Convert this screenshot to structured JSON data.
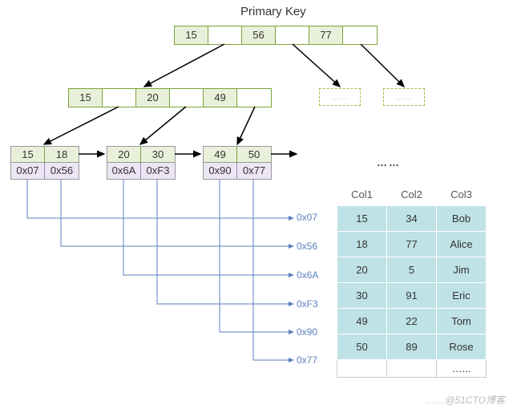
{
  "title": "Primary Key",
  "root": {
    "k1": "15",
    "k2": "56",
    "k3": "77"
  },
  "mid": {
    "k1": "15",
    "k2": "20",
    "k3": "49"
  },
  "ghost_label": "……",
  "leaves": [
    {
      "keys": [
        "15",
        "18"
      ],
      "ptrs": [
        "0x07",
        "0x56"
      ]
    },
    {
      "keys": [
        "20",
        "30"
      ],
      "ptrs": [
        "0x6A",
        "0xF3"
      ]
    },
    {
      "keys": [
        "49",
        "50"
      ],
      "ptrs": [
        "0x90",
        "0x77"
      ]
    }
  ],
  "ellipsis": "……",
  "ptr_labels": [
    "0x07",
    "0x56",
    "0x6A",
    "0xF3",
    "0x90",
    "0x77"
  ],
  "table": {
    "headers": [
      "Col1",
      "Col2",
      "Col3"
    ],
    "rows": [
      [
        "15",
        "34",
        "Bob"
      ],
      [
        "18",
        "77",
        "Alice"
      ],
      [
        "20",
        "5",
        "Jim"
      ],
      [
        "30",
        "91",
        "Eric"
      ],
      [
        "49",
        "22",
        "Tom"
      ],
      [
        "50",
        "89",
        "Rose"
      ]
    ],
    "empty_row": [
      "",
      "",
      "…..."
    ]
  },
  "watermark": "……@51CTO博客",
  "chart_data": {
    "type": "table",
    "title": "Primary Key B+Tree index → heap rows",
    "btree": {
      "root_keys": [
        15,
        56,
        77
      ],
      "internal_keys": [
        15,
        20,
        49
      ],
      "leaves": [
        {
          "keys": [
            15,
            18
          ],
          "pointers": [
            "0x07",
            "0x56"
          ]
        },
        {
          "keys": [
            20,
            30
          ],
          "pointers": [
            "0x6A",
            "0xF3"
          ]
        },
        {
          "keys": [
            49,
            50
          ],
          "pointers": [
            "0x90",
            "0x77"
          ]
        }
      ]
    },
    "heap_rows": [
      {
        "ptr": "0x07",
        "Col1": 15,
        "Col2": 34,
        "Col3": "Bob"
      },
      {
        "ptr": "0x56",
        "Col1": 18,
        "Col2": 77,
        "Col3": "Alice"
      },
      {
        "ptr": "0x6A",
        "Col1": 20,
        "Col2": 5,
        "Col3": "Jim"
      },
      {
        "ptr": "0xF3",
        "Col1": 30,
        "Col2": 91,
        "Col3": "Eric"
      },
      {
        "ptr": "0x90",
        "Col1": 49,
        "Col2": 22,
        "Col3": "Tom"
      },
      {
        "ptr": "0x77",
        "Col1": 50,
        "Col2": 89,
        "Col3": "Rose"
      }
    ]
  }
}
